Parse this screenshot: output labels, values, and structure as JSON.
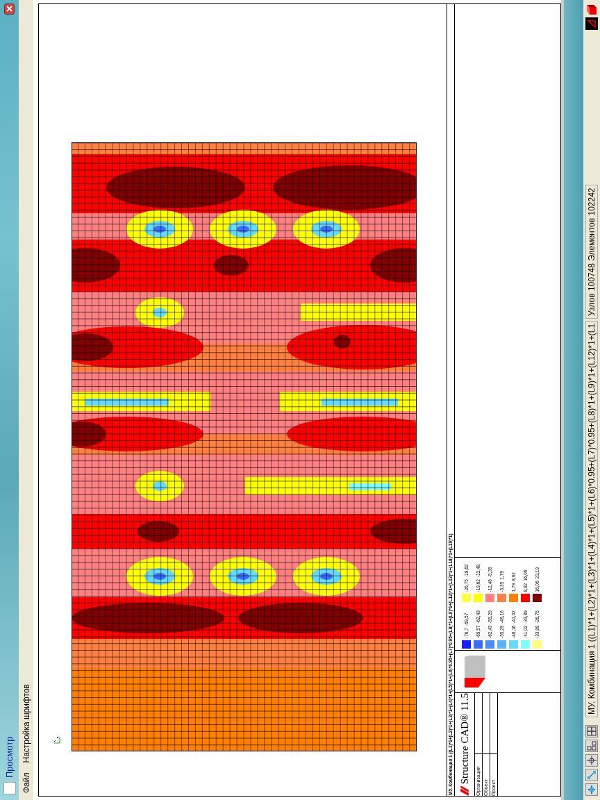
{
  "window": {
    "title": "Просмотр"
  },
  "menu": [
    {
      "label": "Файл"
    },
    {
      "label": "Настройка шрифтов"
    }
  ],
  "title_block": {
    "formula": "МУ. Комбинация 1 ((L1)*1+(L2)*1+(L3)*1+(L4)*1+(L5)*1+(L6)*0.95+(L7)*0.95+(L8)*1+(L9)*1+(L12)*1+(L13)*1+(L18)*1+(L19)*1)",
    "logo_text": "Structure CAD® 11.5",
    "rows": [
      "Организация",
      "Объект",
      "Проект"
    ],
    "legend": [
      {
        "color": "#1a1aff",
        "from": "-76,7",
        "to": "-69,57"
      },
      {
        "color": "#3a6cff",
        "from": "-69,57",
        "to": "-62,43"
      },
      {
        "color": "#4d8cff",
        "from": "-62,43",
        "to": "-55,29"
      },
      {
        "color": "#5ab4ff",
        "from": "-55,29",
        "to": "-48,16"
      },
      {
        "color": "#66d9ff",
        "from": "-48,16",
        "to": "-41,02"
      },
      {
        "color": "#80ffff",
        "from": "-41,02",
        "to": "-33,89"
      },
      {
        "color": "#ffff80",
        "from": "-33,89",
        "to": "-26,75"
      },
      {
        "color": "#ffff40",
        "from": "-26,75",
        "to": "-19,62"
      },
      {
        "color": "#ffff00",
        "from": "-19,62",
        "to": "-12,48"
      },
      {
        "color": "#ff8080",
        "from": "-12,48",
        "to": "-5,35"
      },
      {
        "color": "#ff8040",
        "from": "-5,35",
        "to": "1,79"
      },
      {
        "color": "#ff8000",
        "from": "1,79",
        "to": "8,92"
      },
      {
        "color": "#ff0000",
        "from": "8,92",
        "to": "16,06"
      },
      {
        "color": "#800000",
        "from": "16,06",
        "to": "23,19"
      }
    ]
  },
  "status_bar": {
    "fields": [
      "МУ. Комбинация 1 ((L1)*1+(L2)*1+(L3)*1+(L4)*1+(L5)*1+(L6)*0.95+(L7)*0.95+(L8)*1+(L9)*1+(L12)*1+(L1",
      "Узлов 100748 Элементов 102242"
    ]
  }
}
